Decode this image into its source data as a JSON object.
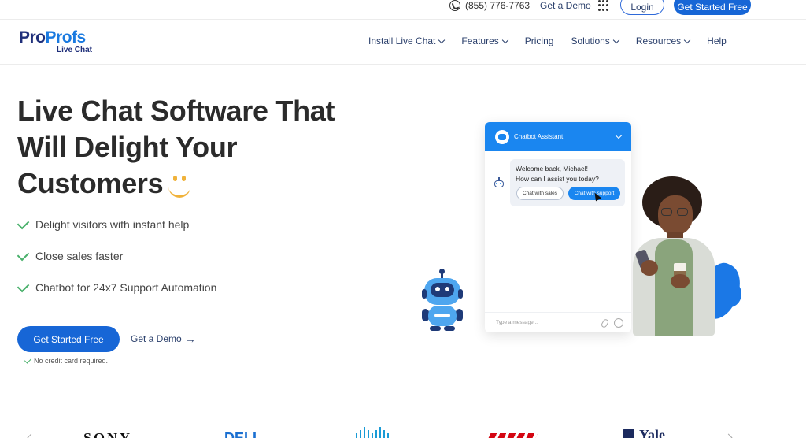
{
  "topbar": {
    "phone": "(855) 776-7763",
    "demo_link": "Get a Demo",
    "login": "Login",
    "cta": "Get Started Free"
  },
  "brand": {
    "name_pro": "Pro",
    "name_profs": "Profs",
    "product": "Live Chat"
  },
  "nav": {
    "items": [
      {
        "label": "Install Live Chat",
        "has_menu": true
      },
      {
        "label": "Features",
        "has_menu": true
      },
      {
        "label": "Pricing",
        "has_menu": false
      },
      {
        "label": "Solutions",
        "has_menu": true
      },
      {
        "label": "Resources",
        "has_menu": true
      },
      {
        "label": "Help",
        "has_menu": false
      }
    ]
  },
  "hero": {
    "title_line1": "Live Chat Software That",
    "title_line2": "Will Delight Your",
    "title_line3": "Customers",
    "features": [
      "Delight visitors with instant help",
      "Close sales faster",
      "Chatbot for 24x7 Support Automation"
    ],
    "cta_primary": "Get Started Free",
    "cta_secondary": "Get a Demo",
    "arrow": "→",
    "note": "No credit card required."
  },
  "chat_widget": {
    "header_title": "Chatbot Assistant",
    "message_line1": "Welcome back, Michael!",
    "message_line2": "How can I assist you today?",
    "quick_replies": [
      "Chat with sales",
      "Chat with support"
    ],
    "input_placeholder": "Type a message..."
  },
  "logos": {
    "sony": "SONY",
    "dell": "DELL",
    "yale": "Yale"
  },
  "colors": {
    "primary": "#1766d6",
    "chat_header": "#1a86f0",
    "brand_dark": "#1f2f7a",
    "check_green": "#49b06b",
    "smile": "#f0b23a"
  }
}
